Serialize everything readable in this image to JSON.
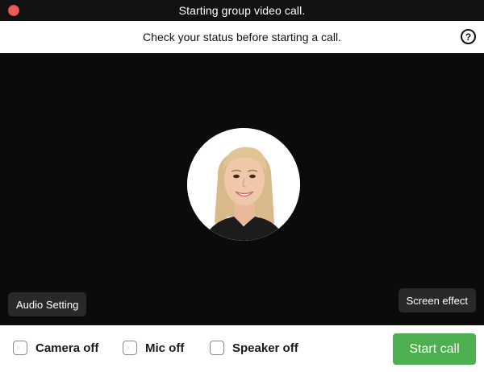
{
  "window": {
    "title": "Starting group video call.",
    "close_color": "#ee5b55"
  },
  "status": {
    "text": "Check your status before starting a call.",
    "help_symbol": "?"
  },
  "video": {
    "background": "#0c0a0a",
    "avatar_icon": "user-avatar-photo",
    "audio_setting_label": "Audio Setting",
    "screen_effect_label": "Screen effect"
  },
  "options": {
    "camera_label": "Camera off",
    "camera_checked": false,
    "mic_label": "Mic off",
    "mic_checked": false,
    "speaker_label": "Speaker off",
    "speaker_checked": false
  },
  "actions": {
    "start_label": "Start call",
    "start_color": "#4caf50"
  }
}
